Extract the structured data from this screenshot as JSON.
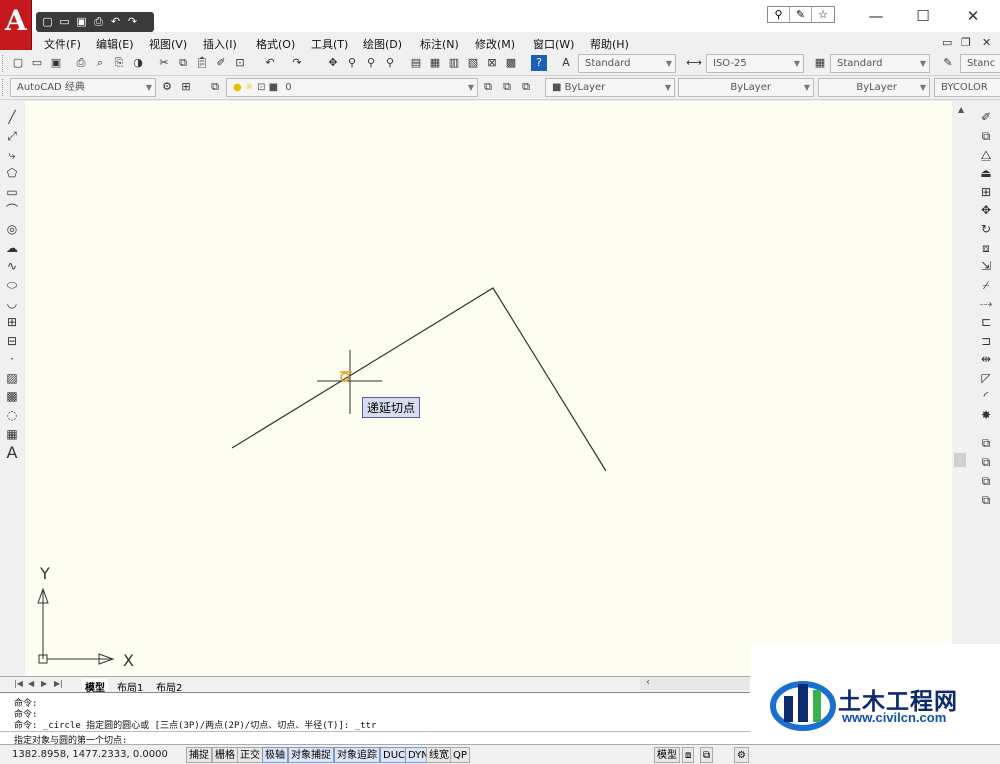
{
  "app": {
    "title_icon": "A",
    "colors": {
      "canvas": "#fdfdf2",
      "logo": "#c6191d",
      "line": "#333333",
      "snap": "#e8a020"
    }
  },
  "qat": {
    "icons": [
      "new-icon",
      "open-icon",
      "save-icon",
      "print-icon",
      "undo-icon",
      "redo-icon"
    ]
  },
  "window": {
    "minimize": "—",
    "maximize": "☐",
    "close": "✕"
  },
  "menu": {
    "items": [
      "文件(F)",
      "编辑(E)",
      "视图(V)",
      "插入(I)",
      "格式(O)",
      "工具(T)",
      "绘图(D)",
      "标注(N)",
      "修改(M)",
      "窗口(W)",
      "帮助(H)"
    ]
  },
  "mdi": {
    "min": "▭",
    "restore": "❐",
    "close": "✕"
  },
  "styles": {
    "text_style": "Standard",
    "dim_style": "ISO-25",
    "table_style": "Standard",
    "ml_style": "Stanc"
  },
  "workspace": {
    "name": "AutoCAD 经典",
    "layer": "0"
  },
  "properties": {
    "color": "ByLayer",
    "linetype": "ByLayer",
    "lineweight": "ByLayer",
    "plotstyle": "BYCOLOR"
  },
  "tooltip": {
    "text": "递延切点"
  },
  "ucs": {
    "x": "X",
    "y": "Y"
  },
  "tabs": {
    "model": "模型",
    "layout1": "布局1",
    "layout2": "布局2"
  },
  "command": {
    "lines": [
      "命令:",
      "命令:",
      "命令: _circle 指定圆的圆心或 [三点(3P)/两点(2P)/切点、切点、半径(T)]: _ttr"
    ],
    "prompt": "指定对象与圆的第一个切点:"
  },
  "status": {
    "coords": "1382.8958, 1477.2333, 0.0000",
    "toggles": [
      "捕捉",
      "栅格",
      "正交",
      "极轴",
      "对象捕捉",
      "对象追踪",
      "DUCS",
      "DYN",
      "线宽",
      "QP"
    ],
    "model": "模型"
  },
  "watermark": {
    "title": "土木工程网",
    "url": "www.civilcn.com"
  }
}
